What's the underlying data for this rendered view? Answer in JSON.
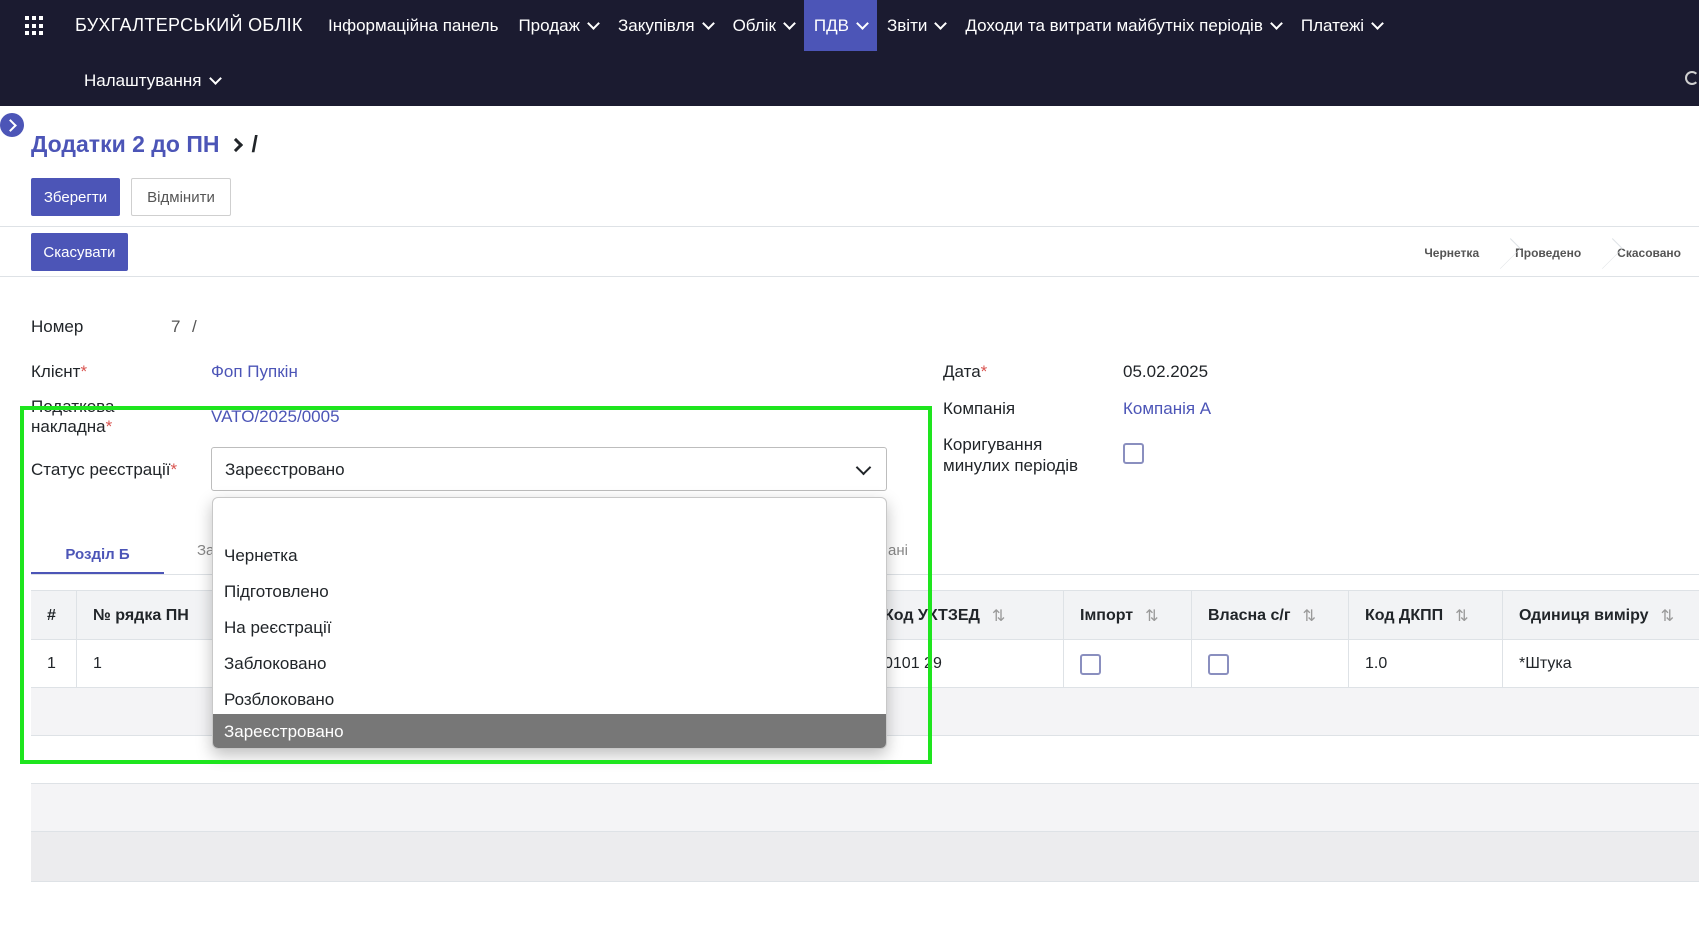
{
  "nav": {
    "brand": "БУХГАЛТЕРСЬКИЙ ОБЛІК",
    "items": [
      {
        "label": "Інформаційна панель",
        "has_dropdown": false,
        "active": false
      },
      {
        "label": "Продаж",
        "has_dropdown": true,
        "active": false
      },
      {
        "label": "Закупівля",
        "has_dropdown": true,
        "active": false
      },
      {
        "label": "Облік",
        "has_dropdown": true,
        "active": false
      },
      {
        "label": "ПДВ",
        "has_dropdown": true,
        "active": true
      },
      {
        "label": "Звіти",
        "has_dropdown": true,
        "active": false
      },
      {
        "label": "Доходи та витрати майбутніх періодів",
        "has_dropdown": true,
        "active": false
      },
      {
        "label": "Платежі",
        "has_dropdown": true,
        "active": false
      }
    ],
    "settings": "Налаштування",
    "bg_color": "#1b1b30",
    "accent_color": "#4c55b7"
  },
  "breadcrumb": {
    "parent": "Додатки 2 до ПН",
    "current": "/"
  },
  "buttons": {
    "save": "Зберегти",
    "discard": "Відмінити",
    "cancel": "Скасувати"
  },
  "statusbar": [
    "Чернетка",
    "Проведено",
    "Скасовано"
  ],
  "form": {
    "number_label": "Номер",
    "number_value": "7",
    "number_suffix": "/",
    "client_label": "Клієнт",
    "client_value": "Фоп Пупкін",
    "invoice_label_line1": "Податкова",
    "invoice_label_line2": "накладна",
    "invoice_value": "VATO/2025/0005",
    "status_label": "Статус реєстрації",
    "status_value": "Зареєстровано",
    "date_label": "Дата",
    "date_value": "05.02.2025",
    "company_label": "Компанія",
    "company_value": "Компанія А",
    "correction_label_line1": "Коригування",
    "correction_label_line2": "минулих періодів",
    "correction_checked": false
  },
  "dropdown": {
    "options": [
      "",
      "Чернетка",
      "Підготовлено",
      "На реєстрації",
      "Заблоковано",
      "Розблоковано",
      "Зареєстровано"
    ],
    "selected": "Зареєстровано"
  },
  "tabs": {
    "active": "Розділ Б",
    "clipped_left": "За",
    "clipped_right": "ані"
  },
  "table": {
    "headers": {
      "num": "#",
      "row_pn": "№ рядка ПН",
      "uktzed": "Код УКТЗЕД",
      "import": "Імпорт",
      "own": "Власна с/г",
      "dkpp": "Код ДКПП",
      "unit": "Одиниця виміру"
    },
    "rows": [
      {
        "num": "1",
        "row_pn": "1",
        "uktzed": "0101 29",
        "import": false,
        "own": false,
        "dkpp": "1.0",
        "unit": "*Штука"
      }
    ],
    "sort_glyph": "⇅"
  }
}
